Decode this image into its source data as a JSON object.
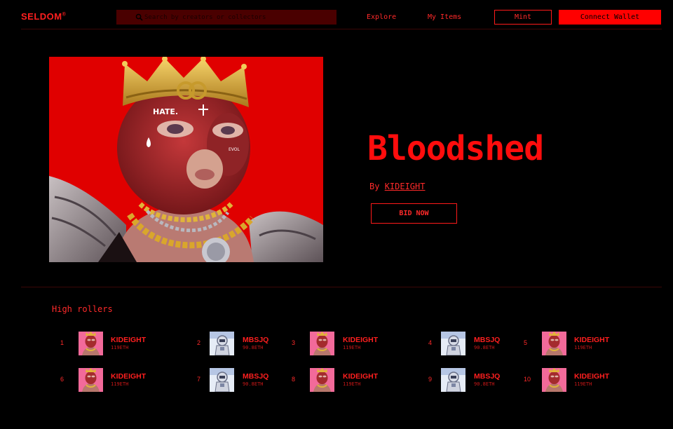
{
  "header": {
    "logo": "SELDOM",
    "logo_mark": "®",
    "search_placeholder": "Search by creators or collectors",
    "nav": [
      {
        "label": "Explore"
      },
      {
        "label": "My Items"
      }
    ],
    "mint_label": "Mint",
    "connect_label": "Connect Wallet"
  },
  "hero": {
    "title": "Bloodshed",
    "by_prefix": "By ",
    "creator": "KIDEIGHT",
    "bid_label": "BID NOW",
    "artwork_text": {
      "forehead": "HATE.",
      "cheek": "EVOL"
    }
  },
  "high_rollers": {
    "title": "High rollers",
    "items": [
      {
        "rank": "1",
        "name": "KIDEIGHT",
        "amount": "119ETH",
        "avatar": "kideight-avatar"
      },
      {
        "rank": "2",
        "name": "MBSJQ",
        "amount": "90.8ETH",
        "avatar": "mbsjq-avatar"
      },
      {
        "rank": "3",
        "name": "KIDEIGHT",
        "amount": "119ETH",
        "avatar": "kideight-avatar"
      },
      {
        "rank": "4",
        "name": "MBSJQ",
        "amount": "90.8ETH",
        "avatar": "mbsjq-avatar"
      },
      {
        "rank": "5",
        "name": "KIDEIGHT",
        "amount": "119ETH",
        "avatar": "kideight-avatar"
      },
      {
        "rank": "6",
        "name": "KIDEIGHT",
        "amount": "119ETH",
        "avatar": "kideight-avatar"
      },
      {
        "rank": "7",
        "name": "MBSJQ",
        "amount": "90.8ETH",
        "avatar": "mbsjq-avatar"
      },
      {
        "rank": "8",
        "name": "KIDEIGHT",
        "amount": "119ETH",
        "avatar": "kideight-avatar"
      },
      {
        "rank": "9",
        "name": "MBSJQ",
        "amount": "90.8ETH",
        "avatar": "mbsjq-avatar"
      },
      {
        "rank": "10",
        "name": "KIDEIGHT",
        "amount": "119ETH",
        "avatar": "kideight-avatar"
      }
    ]
  },
  "colors": {
    "background": "#000000",
    "accent": "#ff0000",
    "search_bg": "#4a0000",
    "divider": "#3a0606"
  }
}
